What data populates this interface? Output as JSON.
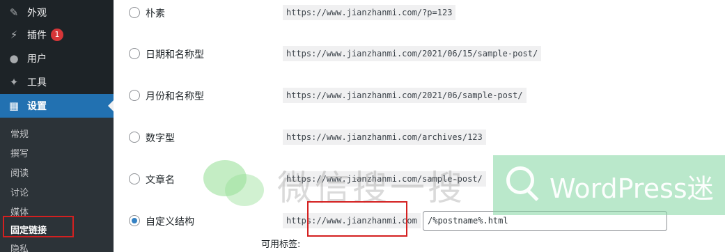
{
  "sidebar": {
    "menu": [
      {
        "label": "外观",
        "icon": "brush-icon"
      },
      {
        "label": "插件",
        "icon": "plugin-icon",
        "badge": "1"
      },
      {
        "label": "用户",
        "icon": "user-icon"
      },
      {
        "label": "工具",
        "icon": "wrench-icon"
      },
      {
        "label": "设置",
        "icon": "settings-icon",
        "current": true
      }
    ],
    "submenu": [
      "常规",
      "撰写",
      "阅读",
      "讨论",
      "媒体",
      "固定链接",
      "隐私"
    ],
    "active_submenu": "固定链接"
  },
  "permalinks": {
    "options": [
      {
        "label": "朴素",
        "example": "https://www.jianzhanmi.com/?p=123",
        "checked": false
      },
      {
        "label": "日期和名称型",
        "example": "https://www.jianzhanmi.com/2021/06/15/sample-post/",
        "checked": false
      },
      {
        "label": "月份和名称型",
        "example": "https://www.jianzhanmi.com/2021/06/sample-post/",
        "checked": false
      },
      {
        "label": "数字型",
        "example": "https://www.jianzhanmi.com/archives/123",
        "checked": false
      },
      {
        "label": "文章名",
        "example": "https://www.jianzhanmi.com/sample-post/",
        "checked": false
      },
      {
        "label": "自定义结构",
        "example": "https://www.jianzhanmi.com",
        "checked": true
      }
    ],
    "custom_structure_value": "/%postname%.html",
    "available_tags_label": "可用标签:"
  },
  "watermark": {
    "text": "微信搜一搜",
    "brand": "WordPress迷"
  },
  "colors": {
    "sidebar_bg": "#1d2327",
    "accent": "#2271b1",
    "badge": "#d63638",
    "highlight_box": "#d42020"
  }
}
